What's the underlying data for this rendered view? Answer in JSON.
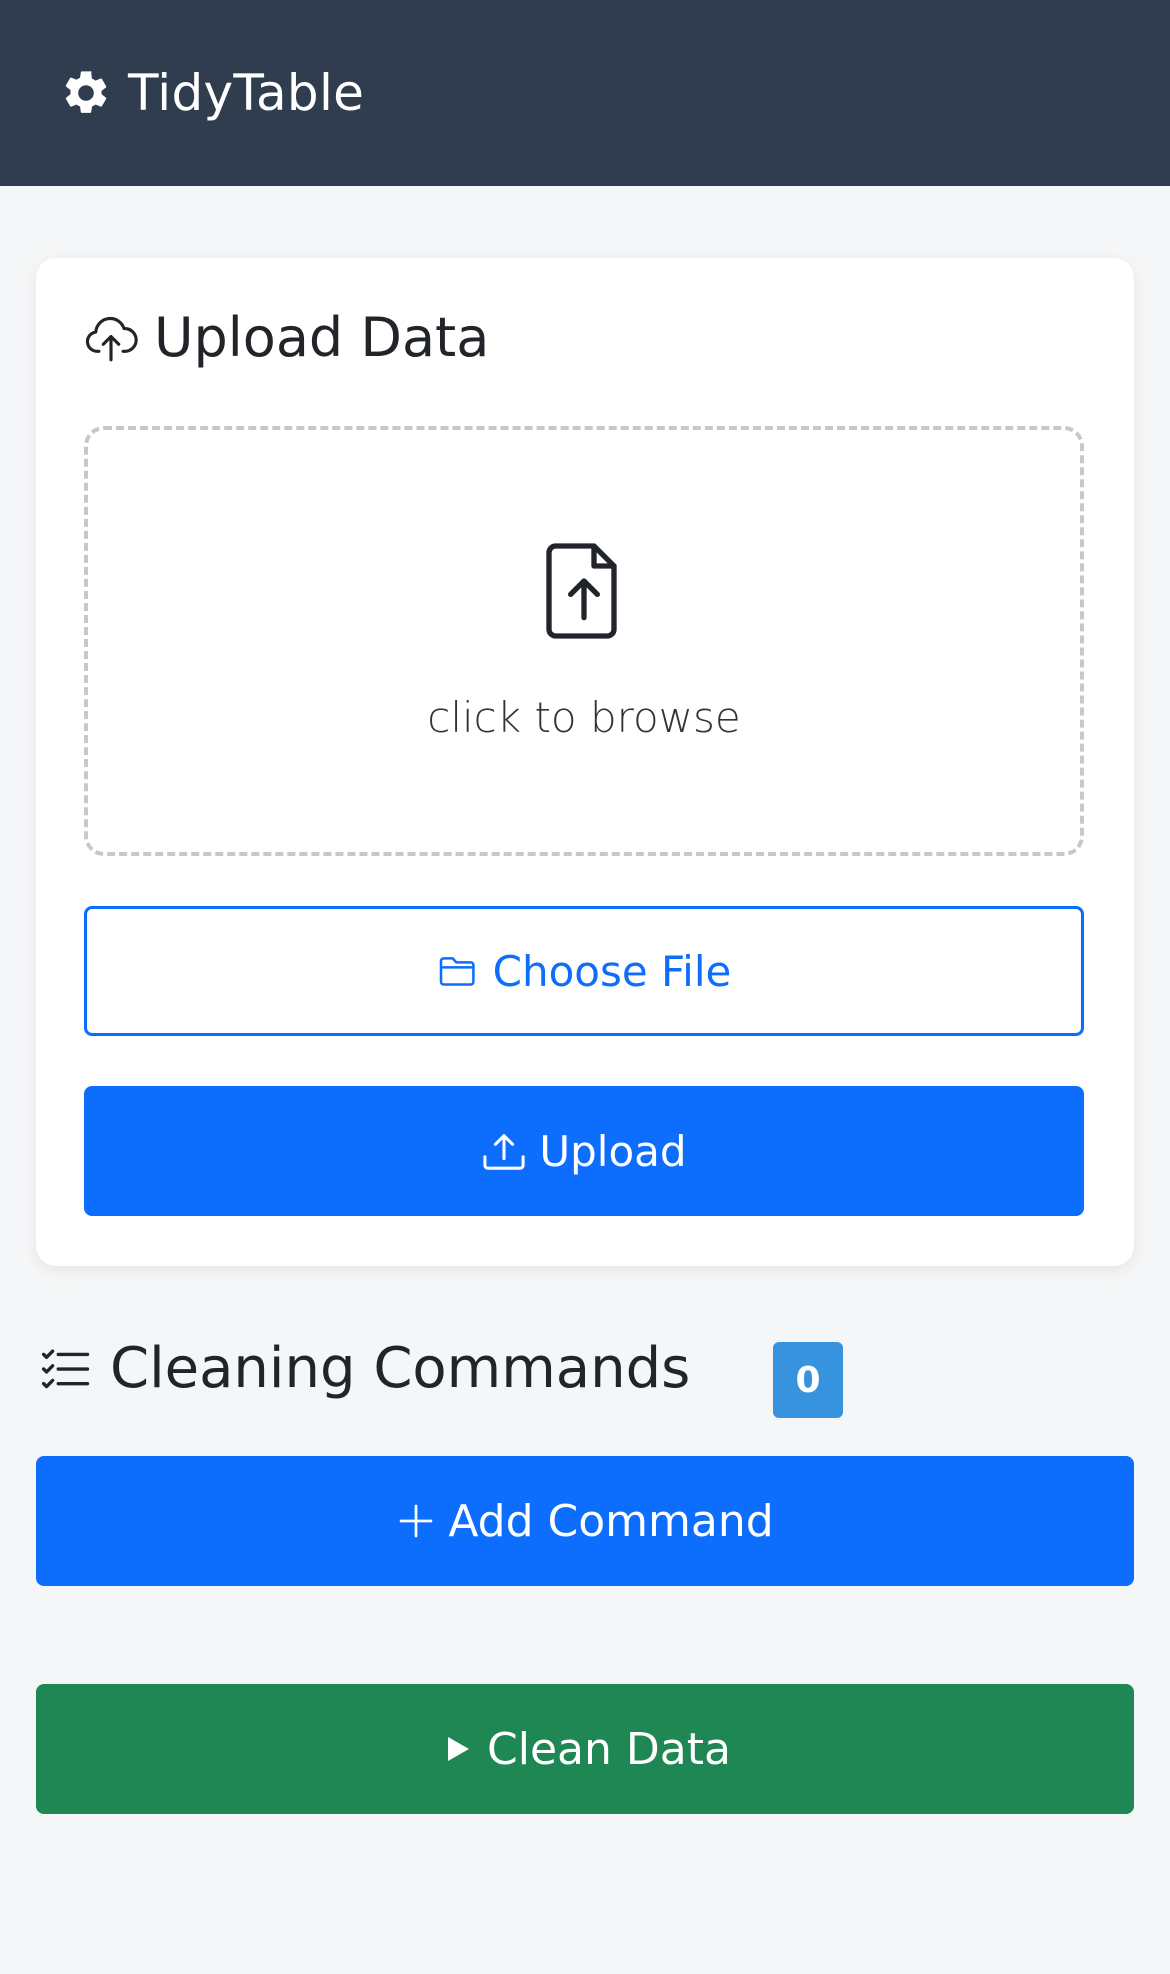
{
  "app": {
    "brand_name": "TidyTable",
    "brand_icon": "gear-icon"
  },
  "upload": {
    "title": "Upload Data",
    "title_icon": "cloud-upload-icon",
    "dropzone_icon": "file-upload-icon",
    "dropzone_text": "click to browse",
    "choose_file_label": "Choose File",
    "choose_file_icon": "folder-icon",
    "upload_label": "Upload",
    "upload_icon": "upload-icon"
  },
  "commands": {
    "title": "Cleaning Commands",
    "title_icon": "list-check-icon",
    "count": "0",
    "add_label": "Add Command",
    "add_icon": "plus-icon"
  },
  "actions": {
    "clean_label": "Clean Data",
    "clean_icon": "play-icon"
  },
  "colors": {
    "navbar": "#2f3d4f",
    "primary": "#0d6efd",
    "success": "#1e8754",
    "badge": "#3793dd",
    "background": "#f5f6f7"
  }
}
